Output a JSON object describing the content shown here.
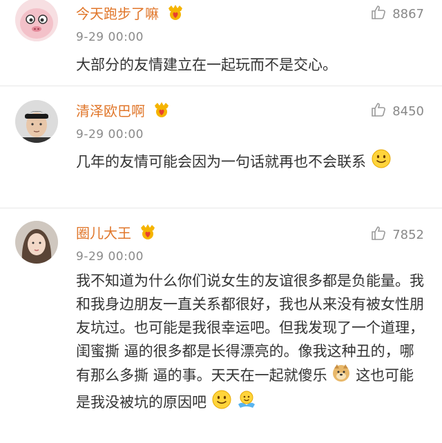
{
  "comments": [
    {
      "username": "今天跑步了嘛",
      "time": "9-29 00:00",
      "likes": "8867",
      "text": "大部分的友情建立在一起玩而不是交心。"
    },
    {
      "username": "清泽欧巴啊",
      "time": "9-29 00:00",
      "likes": "8450",
      "text": "几年的友情可能会因为一句话就再也不会联系"
    },
    {
      "username": "圈儿大王",
      "time": "9-29 00:00",
      "likes": "7852",
      "text_1": "我不知道为什么你们说女生的友谊很多都是负能量。我和我身边朋友一直关系都很好，我也从来没有被女性朋友坑过。也可能是我很幸运吧。但我发现了一个道理，闺蜜撕 逼的很多都是长得漂亮的。像我这种丑的，哪有那么多撕 逼的事。天天在一起就傻乐",
      "text_2": "这也可能是我没被坑的原因吧"
    }
  ],
  "colors": {
    "username": "#e0762a",
    "time": "#8a8a8a",
    "text": "#333333",
    "divider": "#e8e8e8"
  },
  "icons": {
    "like": "thumbs-up-outline-icon",
    "badge": "vip-heart-crown-icon",
    "smile": "smiley-emoji-icon",
    "doge": "doge-emoji-icon",
    "hug": "hug-emoji-icon"
  }
}
